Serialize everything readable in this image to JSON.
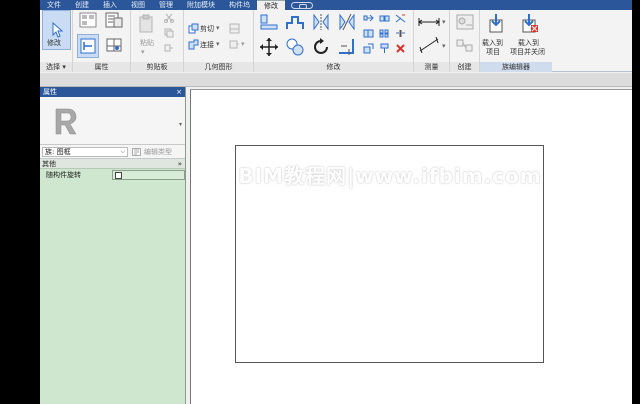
{
  "tabs": [
    {
      "label": "文件"
    },
    {
      "label": "创建"
    },
    {
      "label": "插入"
    },
    {
      "label": "视图"
    },
    {
      "label": "管理"
    },
    {
      "label": "附加模块"
    },
    {
      "label": "构件坞"
    },
    {
      "label": "修改",
      "active": true
    }
  ],
  "ribbon": {
    "select": {
      "panel_label": "选择 ▾",
      "modify_label": "修改"
    },
    "properties": {
      "panel_label": "属性"
    },
    "clipboard": {
      "panel_label": "剪贴板",
      "paste_label": "粘贴"
    },
    "geometry": {
      "panel_label": "几何图形",
      "cut_label": "剪切",
      "join_label": "连接"
    },
    "modify": {
      "panel_label": "修改"
    },
    "measure": {
      "panel_label": "测量"
    },
    "create": {
      "panel_label": "创建"
    },
    "family_editor": {
      "panel_label": "族编辑器",
      "load_into_project_line1": "载入到",
      "load_into_project_line2": "项目",
      "load_close_line1": "载入到",
      "load_close_line2": "项目并关闭"
    }
  },
  "properties": {
    "title": "属性",
    "close": "×",
    "family_label": "族: 图框",
    "edit_type_label": "编辑类型",
    "section_label": "其他",
    "section_toggle": "»",
    "params": [
      {
        "name": "随构件旋转",
        "checked": false
      }
    ]
  },
  "canvas": {
    "watermark": "BIM教程网|www.ifbim.com"
  },
  "colors": {
    "tab_bar": "#2b579a",
    "properties_bg": "#cfe6cf",
    "accent_blue": "#2f6fd0",
    "delete_red": "#d9342b"
  }
}
